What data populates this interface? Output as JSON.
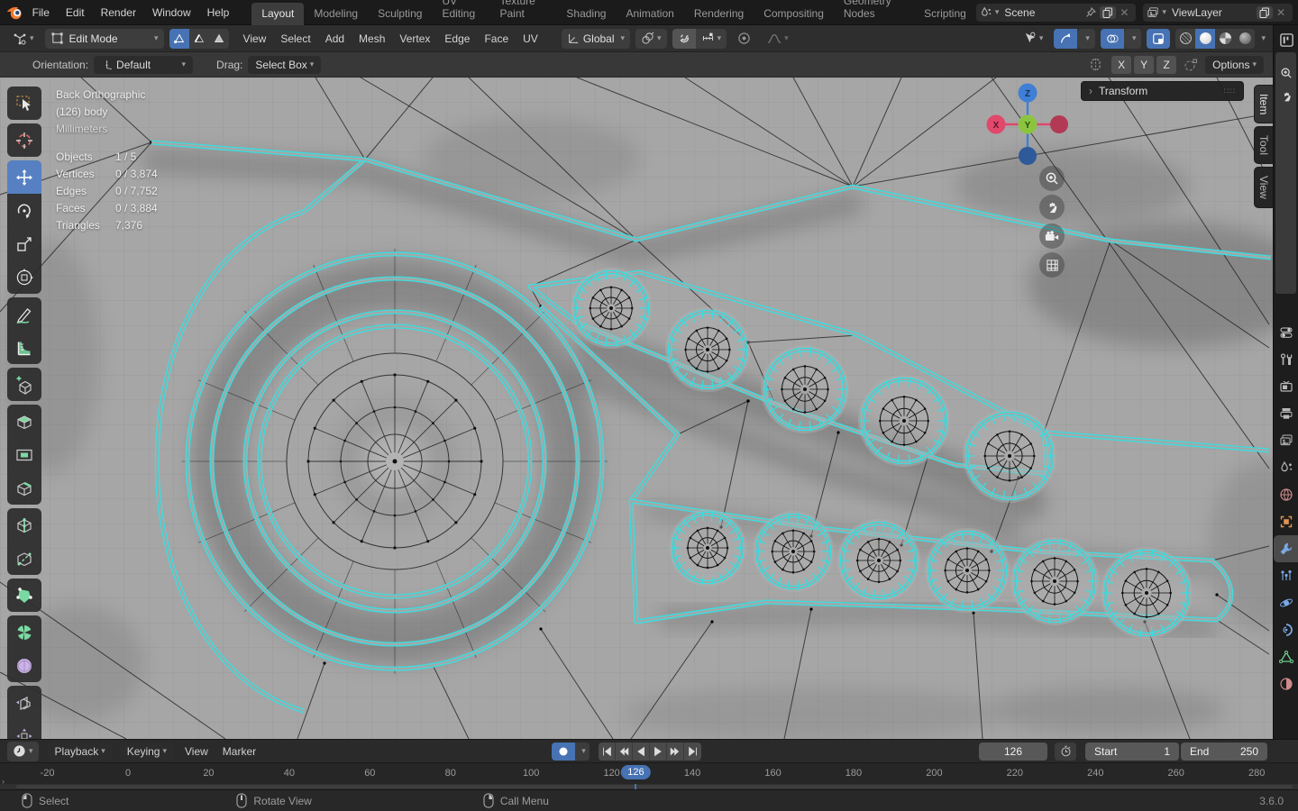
{
  "topbar": {
    "menus": [
      "File",
      "Edit",
      "Render",
      "Window",
      "Help"
    ],
    "tabs": [
      "Layout",
      "Modeling",
      "Sculpting",
      "UV Editing",
      "Texture Paint",
      "Shading",
      "Animation",
      "Rendering",
      "Compositing",
      "Geometry Nodes",
      "Scripting"
    ],
    "active_tab": "Layout",
    "scene_value": "Scene",
    "viewlayer_value": "ViewLayer"
  },
  "viewport_header": {
    "mode": "Edit Mode",
    "menus": [
      "View",
      "Select",
      "Add",
      "Mesh",
      "Vertex",
      "Edge",
      "Face",
      "UV"
    ],
    "orientation": "Global",
    "select_modes": [
      "vertex-select-mode",
      "edge-select-mode",
      "face-select-mode"
    ],
    "active_select_mode": "vertex-select-mode"
  },
  "tool_settings": {
    "orientation_label": "Orientation:",
    "orientation_value": "Default",
    "drag_label": "Drag:",
    "drag_value": "Select Box",
    "axis_buttons": [
      "X",
      "Y",
      "Z"
    ],
    "options_label": "Options"
  },
  "viewport": {
    "overlay": {
      "view": "Back Orthographic",
      "object": "(126) body",
      "units": "Millimeters",
      "stats": [
        {
          "label": "Objects",
          "value": "1 / 5"
        },
        {
          "label": "Vertices",
          "value": "0 / 3,874"
        },
        {
          "label": "Edges",
          "value": "0 / 7,752"
        },
        {
          "label": "Faces",
          "value": "0 / 3,884"
        },
        {
          "label": "Triangles",
          "value": "7,376"
        }
      ]
    },
    "gizmo_axes": {
      "x": "X",
      "y": "Y",
      "z": "Z"
    },
    "sidebar_tabs": [
      {
        "label": "Item",
        "active": true
      },
      {
        "label": "Tool",
        "active": false
      },
      {
        "label": "View",
        "active": false
      }
    ],
    "transform_panel_title": "Transform"
  },
  "toolbar_tools": [
    {
      "name": "select-box",
      "group": 0
    },
    {
      "name": "cursor",
      "group": 1
    },
    {
      "name": "move",
      "group": 2,
      "active": true
    },
    {
      "name": "rotate",
      "group": 2
    },
    {
      "name": "scale",
      "group": 2
    },
    {
      "name": "transform",
      "group": 2
    },
    {
      "name": "annotate",
      "group": 3
    },
    {
      "name": "measure",
      "group": 3
    },
    {
      "name": "add-cube",
      "group": 4
    },
    {
      "name": "extrude-region",
      "group": 5
    },
    {
      "name": "inset-faces",
      "group": 5
    },
    {
      "name": "bevel",
      "group": 5
    },
    {
      "name": "loop-cut",
      "group": 6
    },
    {
      "name": "knife",
      "group": 6
    },
    {
      "name": "poly-build",
      "group": 7
    },
    {
      "name": "spin",
      "group": 8
    },
    {
      "name": "smooth",
      "group": 8
    },
    {
      "name": "edge-slide",
      "group": 9
    },
    {
      "name": "shrink-fatten",
      "group": 9
    }
  ],
  "properties_tabs": [
    {
      "name": "properties-editor"
    },
    {
      "name": "tool"
    },
    {
      "name": "render"
    },
    {
      "name": "output"
    },
    {
      "name": "view-layer"
    },
    {
      "name": "scene"
    },
    {
      "name": "world"
    },
    {
      "name": "object"
    },
    {
      "name": "modifiers",
      "active": true
    },
    {
      "name": "particles"
    },
    {
      "name": "physics"
    },
    {
      "name": "object-constraints"
    },
    {
      "name": "object-data"
    },
    {
      "name": "material"
    }
  ],
  "timeline": {
    "menus": [
      {
        "label": "Playback",
        "dropdown": true
      },
      {
        "label": "Keying",
        "dropdown": true
      },
      {
        "label": "View",
        "dropdown": false
      },
      {
        "label": "Marker",
        "dropdown": false
      }
    ],
    "transport": [
      "jump-to-start",
      "previous-keyframe",
      "play-reverse",
      "play",
      "next-keyframe",
      "jump-to-end"
    ],
    "current_frame": "126",
    "start_label": "Start",
    "start_value": "1",
    "end_label": "End",
    "end_value": "250",
    "ruler_ticks": [
      -20,
      0,
      20,
      40,
      60,
      80,
      100,
      120,
      140,
      160,
      180,
      200,
      220,
      240,
      260,
      280
    ]
  },
  "status_bar": {
    "items": [
      {
        "icon": "mouse-left-button",
        "label": "Select"
      },
      {
        "icon": "mouse-middle-button",
        "label": "Rotate View"
      },
      {
        "icon": "mouse-right-button",
        "label": "Call Menu"
      }
    ],
    "version": "3.6.0"
  },
  "colors": {
    "accent_blue": "#4772b3",
    "selection_cyan": "#35e0e3",
    "axis_x": "#e0486c",
    "axis_y": "#8bc53f",
    "axis_z": "#3f7fd6"
  }
}
